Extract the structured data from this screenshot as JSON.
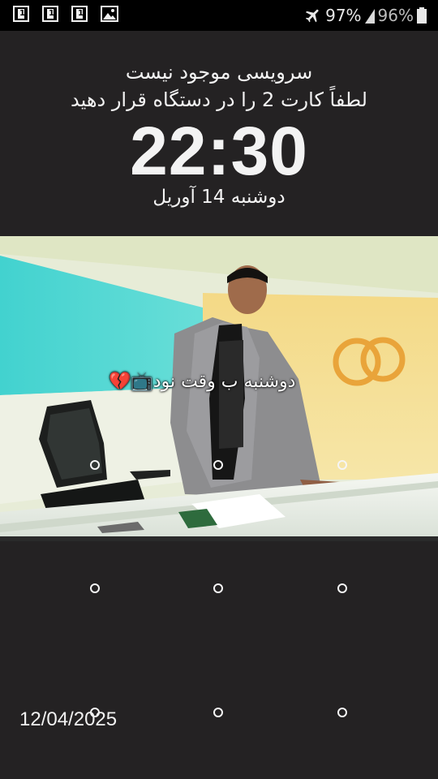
{
  "status_bar": {
    "notifications": [
      "sim-1-icon",
      "sim-1-icon",
      "sim-1-icon",
      "gallery-icon"
    ],
    "airplane_icon": "airplane-icon",
    "battery_text_1": "97%",
    "battery_text_2": "96%",
    "overlap_text": "22:30"
  },
  "lock": {
    "no_service": "سرویسی موجود نیست",
    "insert_sim": "لطفاً کارت 2 را در دستگاه قرار دهید",
    "time": "22:30",
    "date": "دوشنبه 14 آوریل"
  },
  "wallpaper": {
    "caption": "دوشنبه ب وقت نود📺💔"
  },
  "pattern_lock": {
    "rows": 3,
    "cols": 3
  },
  "footer": {
    "date": "12/04/2025"
  }
}
